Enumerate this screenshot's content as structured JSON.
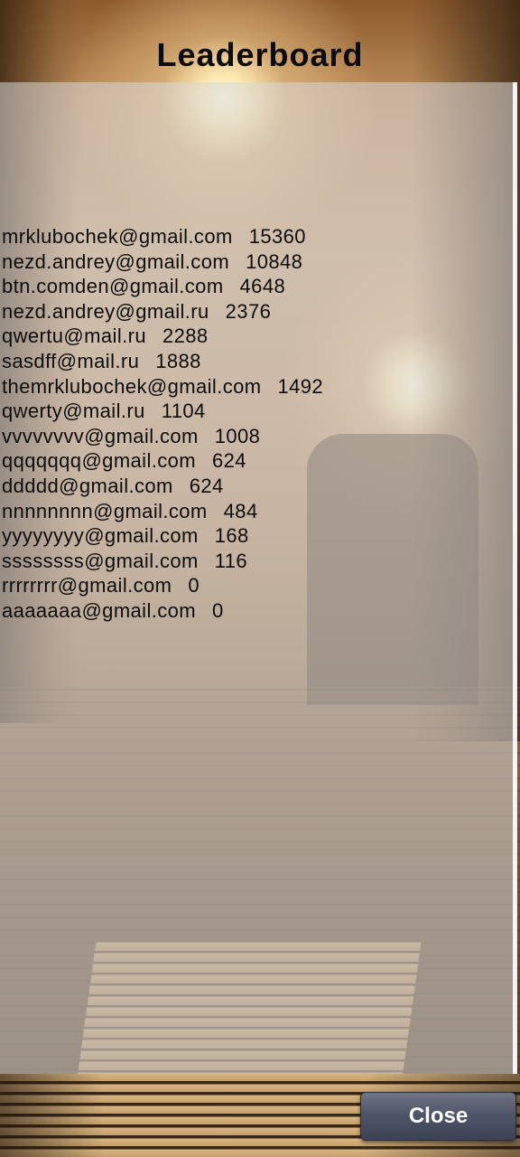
{
  "title": "Leaderboard",
  "close_label": "Close",
  "entries": [
    {
      "email": "mrklubochek@gmail.com",
      "score": "15360"
    },
    {
      "email": "nezd.andrey@gmail.com",
      "score": "10848"
    },
    {
      "email": "btn.comden@gmail.com",
      "score": "4648"
    },
    {
      "email": "nezd.andrey@gmail.ru",
      "score": "2376"
    },
    {
      "email": "qwertu@mail.ru",
      "score": "2288"
    },
    {
      "email": "sasdff@mail.ru",
      "score": "1888"
    },
    {
      "email": "themrklubochek@gmail.com",
      "score": "1492"
    },
    {
      "email": "qwerty@mail.ru",
      "score": "1104"
    },
    {
      "email": "vvvvvvvv@gmail.com",
      "score": "1008"
    },
    {
      "email": "qqqqqqq@gmail.com",
      "score": "624"
    },
    {
      "email": "ddddd@gmail.com",
      "score": "624"
    },
    {
      "email": "nnnnnnnn@gmail.com",
      "score": "484"
    },
    {
      "email": "yyyyyyyy@gmail.com",
      "score": "168"
    },
    {
      "email": "ssssssss@gmail.com",
      "score": "116"
    },
    {
      "email": "rrrrrrrr@gmail.com",
      "score": "0"
    },
    {
      "email": "aaaaaaa@gmail.com",
      "score": "0"
    }
  ]
}
